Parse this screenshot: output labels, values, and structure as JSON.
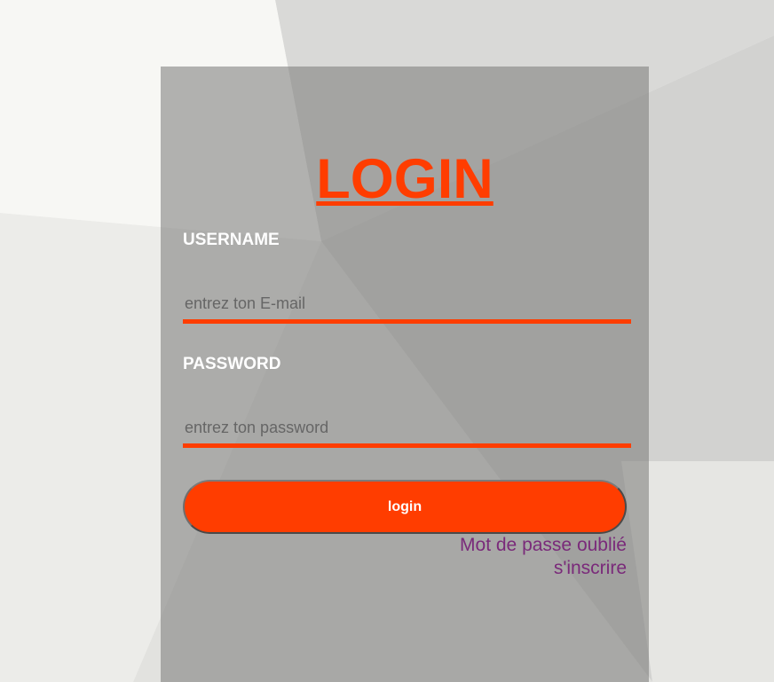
{
  "colors": {
    "accent": "#ff3d00",
    "link": "#7a2a7a",
    "card_bg": "rgba(120,120,118,0.55)"
  },
  "login_form": {
    "title": "LOGIN",
    "username": {
      "label": "USERNAME",
      "value": "",
      "placeholder": "entrez ton E-mail"
    },
    "password": {
      "label": "PASSWORD",
      "value": "",
      "placeholder": "entrez ton password"
    },
    "submit_label": "login",
    "forgot_password_link": "Mot de passe oublié",
    "signup_link": "s'inscrire"
  }
}
